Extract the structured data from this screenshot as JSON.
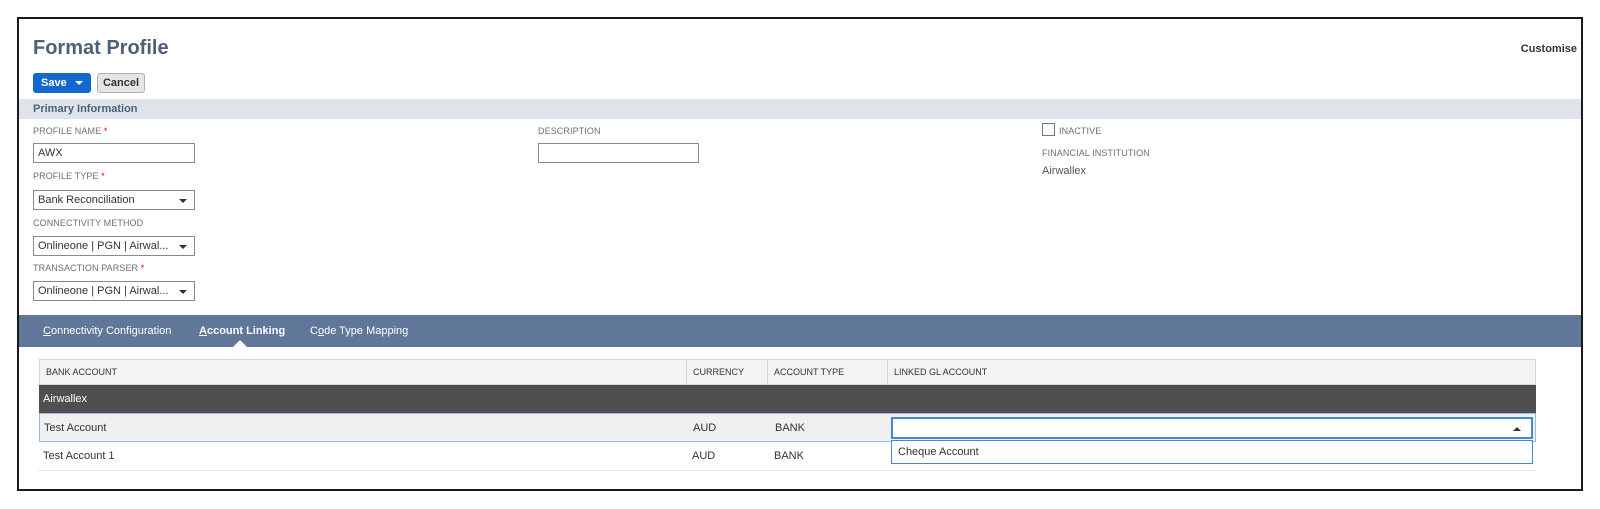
{
  "page": {
    "title": "Format Profile",
    "customise_label": "Customise"
  },
  "toolbar": {
    "save_label": "Save",
    "cancel_label": "Cancel"
  },
  "primary_section": {
    "title": "Primary Information",
    "profile_name": {
      "label": "PROFILE NAME",
      "required": "*",
      "value": "AWX"
    },
    "description": {
      "label": "DESCRIPTION",
      "value": ""
    },
    "profile_type": {
      "label": "PROFILE TYPE",
      "required": "*",
      "value": "Bank Reconciliation"
    },
    "connectivity_method": {
      "label": "CONNECTIVITY METHOD",
      "value": "Onlineone | PGN | Airwal..."
    },
    "transaction_parser": {
      "label": "TRANSACTION PARSER",
      "required": "*",
      "value": "Onlineone | PGN | Airwal..."
    },
    "inactive": {
      "label": "INACTIVE",
      "checked": false
    },
    "financial_institution": {
      "label": "FINANCIAL INSTITUTION",
      "value": "Airwallex"
    }
  },
  "tabs": [
    {
      "label_pre": "",
      "label_key": "C",
      "label_post": "onnectivity Configuration",
      "active": false
    },
    {
      "label_pre": "",
      "label_key": "A",
      "label_post": "ccount Linking",
      "active": true
    },
    {
      "label_pre": "C",
      "label_key": "o",
      "label_post": "de Type Mapping",
      "active": false
    }
  ],
  "account_table": {
    "columns": [
      "BANK ACCOUNT",
      "CURRENCY",
      "ACCOUNT TYPE",
      "LINKED GL ACCOUNT"
    ],
    "group": "Airwallex",
    "rows": [
      {
        "bank_account": "Test Account",
        "currency": "AUD",
        "account_type": "BANK",
        "linked_gl": ""
      },
      {
        "bank_account": "Test Account 1",
        "currency": "AUD",
        "account_type": "BANK",
        "linked_gl": ""
      }
    ],
    "gl_dropdown_options": [
      "Cheque Account"
    ]
  },
  "colors": {
    "accent": "#1467cc",
    "title": "#4d5f79",
    "tab_bar": "#607799",
    "section_bar": "#dfe4eb",
    "group_row": "#4f4f4f"
  }
}
